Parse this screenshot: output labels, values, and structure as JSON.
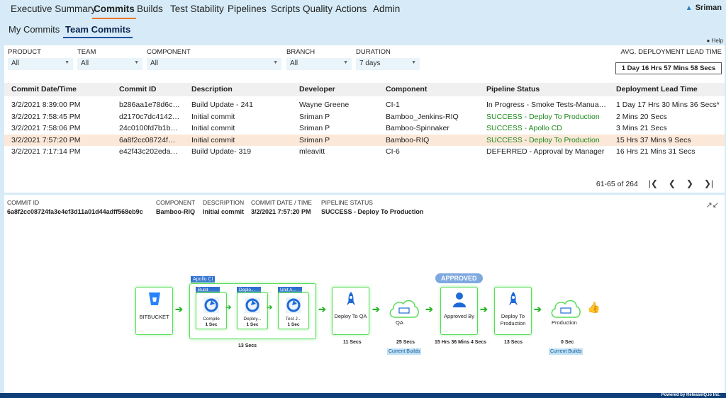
{
  "nav": {
    "tabs": [
      "Executive Summary",
      "Commits",
      "Builds",
      "Test Stability",
      "Pipelines",
      "Scripts Quality",
      "Actions",
      "Admin"
    ],
    "active": "Commits",
    "user": "Sriman"
  },
  "subnav": {
    "tabs": [
      "My Commits",
      "Team Commits"
    ],
    "active": "Team Commits",
    "help": "Help"
  },
  "filters": {
    "product": {
      "label": "PRODUCT",
      "value": "All"
    },
    "team": {
      "label": "TEAM",
      "value": "All"
    },
    "component": {
      "label": "COMPONENT",
      "value": "All"
    },
    "branch": {
      "label": "BRANCH",
      "value": "All"
    },
    "duration": {
      "label": "DURATION",
      "value": "7 days"
    },
    "avg_label": "AVG. DEPLOYMENT LEAD TIME",
    "avg_value": "1 Day 16 Hrs 57 Mins 58 Secs"
  },
  "table": {
    "columns": [
      "Commit Date/Time",
      "Commit ID",
      "Description",
      "Developer",
      "Component",
      "Pipeline Status",
      "Deployment Lead Time"
    ],
    "rows": [
      [
        "3/2/2021 8:39:00 PM",
        "b286aa1e78d6c…",
        "Build Update - 241",
        "Wayne Greene",
        "CI-1",
        "In Progress - Smoke Tests-Manua…",
        "1 Day 17 Hrs 30 Mins 36 Secs*"
      ],
      [
        "3/2/2021 7:58:45 PM",
        "d2170c7dc4142…",
        "Initial commit",
        "Sriman P",
        "Bamboo_Jenkins-RIQ",
        "SUCCESS - Deploy To Production",
        "2 Mins 20 Secs"
      ],
      [
        "3/2/2021 7:58:06 PM",
        "24c0100fd7b1b…",
        "Initial commit",
        "Sriman P",
        "Bamboo-Spinnaker",
        "SUCCESS - Apollo CD",
        "3 Mins 21 Secs"
      ],
      [
        "3/2/2021 7:57:20 PM",
        "6a8f2cc08724f…",
        "Initial commit",
        "Sriman P",
        "Bamboo-RIQ",
        "SUCCESS - Deploy To Production",
        "15 Hrs 37 Mins 9 Secs"
      ],
      [
        "3/2/2021 7:17:14 PM",
        "e42f43c202eda…",
        "Build Update- 319",
        "mleavitt",
        "CI-6",
        "DEFERRED - Approval by Manager",
        "16 Hrs 21 Mins 31 Secs"
      ]
    ],
    "success_rows": [
      1,
      2,
      3
    ],
    "selected_row": 3,
    "pagination": "61-65 of 264"
  },
  "detail": {
    "commit_id_label": "COMMIT ID",
    "commit_id": "6a8f2cc08724fa3e4ef3d11a01d44adff568eb9c",
    "component_label": "COMPONENT",
    "component": "Bamboo-RIQ",
    "description_label": "DESCRIPTION",
    "description": "Initial commit",
    "date_label": "COMMIT DATE / TIME",
    "date": "3/2/2021 7:57:20 PM",
    "status_label": "PIPELINE STATUS",
    "status": "SUCCESS - Deploy To Production"
  },
  "pipeline": {
    "bitbucket": "BITBUCKET",
    "apollo_ci": {
      "tag": "Apollo CI",
      "time": "13 Secs",
      "tasks": [
        {
          "tag": "Build",
          "label": "Compile",
          "time": "1 Sec"
        },
        {
          "tag": "Deplo...",
          "label": "Deploy...",
          "time": "1 Sec"
        },
        {
          "tag": "Unit A...",
          "label": "Test J...",
          "time": "1 Sec"
        }
      ]
    },
    "deploy_qa": {
      "label": "Deploy To QA",
      "time": "11 Secs"
    },
    "qa": {
      "label": "QA",
      "time": "25 Secs",
      "builds": "Current Builds"
    },
    "approved": {
      "badge": "APPROVED",
      "label": "Approved By",
      "time": "15 Hrs 36 Mins 4 Secs"
    },
    "deploy_prod": {
      "label": "Deploy To Production",
      "time": "13 Secs"
    },
    "production": {
      "label": "Production",
      "time": "0 Sec",
      "builds": "Current Builds"
    }
  },
  "footer": "Powered by ReleaseIQ.io Inc.",
  "colors": {
    "success": "#1d8a1d",
    "accent": "#e9772b",
    "header_bg": "#d6ebf7",
    "stage_border": "#58dc58"
  }
}
